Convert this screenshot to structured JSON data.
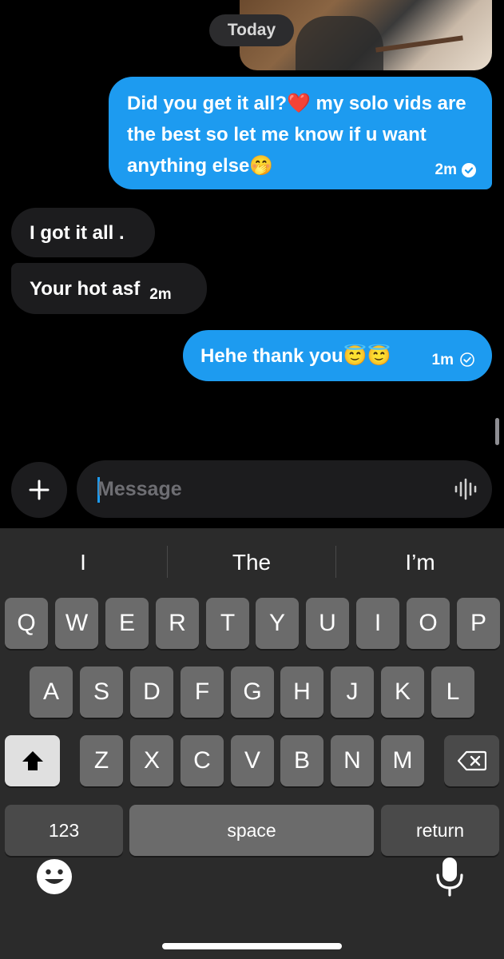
{
  "chat": {
    "date_label": "Today",
    "messages": [
      {
        "direction": "outgoing",
        "text": "Did you get it all?❤️ my solo vids are the best so let me know if u want anything else🤭",
        "time": "2m",
        "status": "read"
      },
      {
        "direction": "incoming",
        "text": "I got it all ."
      },
      {
        "direction": "incoming",
        "text": "Your hot asf",
        "time": "2m"
      },
      {
        "direction": "outgoing",
        "text": "Hehe thank you😇😇",
        "time": "1m",
        "status": "sent"
      }
    ]
  },
  "composer": {
    "placeholder": "Message",
    "add_icon": "plus-icon",
    "voice_icon": "voice-wave-icon"
  },
  "keyboard": {
    "suggestions": [
      "I",
      "The",
      "I’m"
    ],
    "row1": [
      "Q",
      "W",
      "E",
      "R",
      "T",
      "Y",
      "U",
      "I",
      "O",
      "P"
    ],
    "row2": [
      "A",
      "S",
      "D",
      "F",
      "G",
      "H",
      "J",
      "K",
      "L"
    ],
    "row3": [
      "Z",
      "X",
      "C",
      "V",
      "B",
      "N",
      "M"
    ],
    "numbers_label": "123",
    "space_label": "space",
    "return_label": "return",
    "shift_icon": "shift-icon",
    "backspace_icon": "backspace-icon",
    "emoji_icon": "emoji-icon",
    "mic_icon": "microphone-icon"
  },
  "colors": {
    "accent": "#1d9bf0",
    "background": "#000000",
    "bubble_incoming": "#1c1c1e",
    "keyboard_bg": "#2b2b2b",
    "key": "#6b6b6b"
  }
}
